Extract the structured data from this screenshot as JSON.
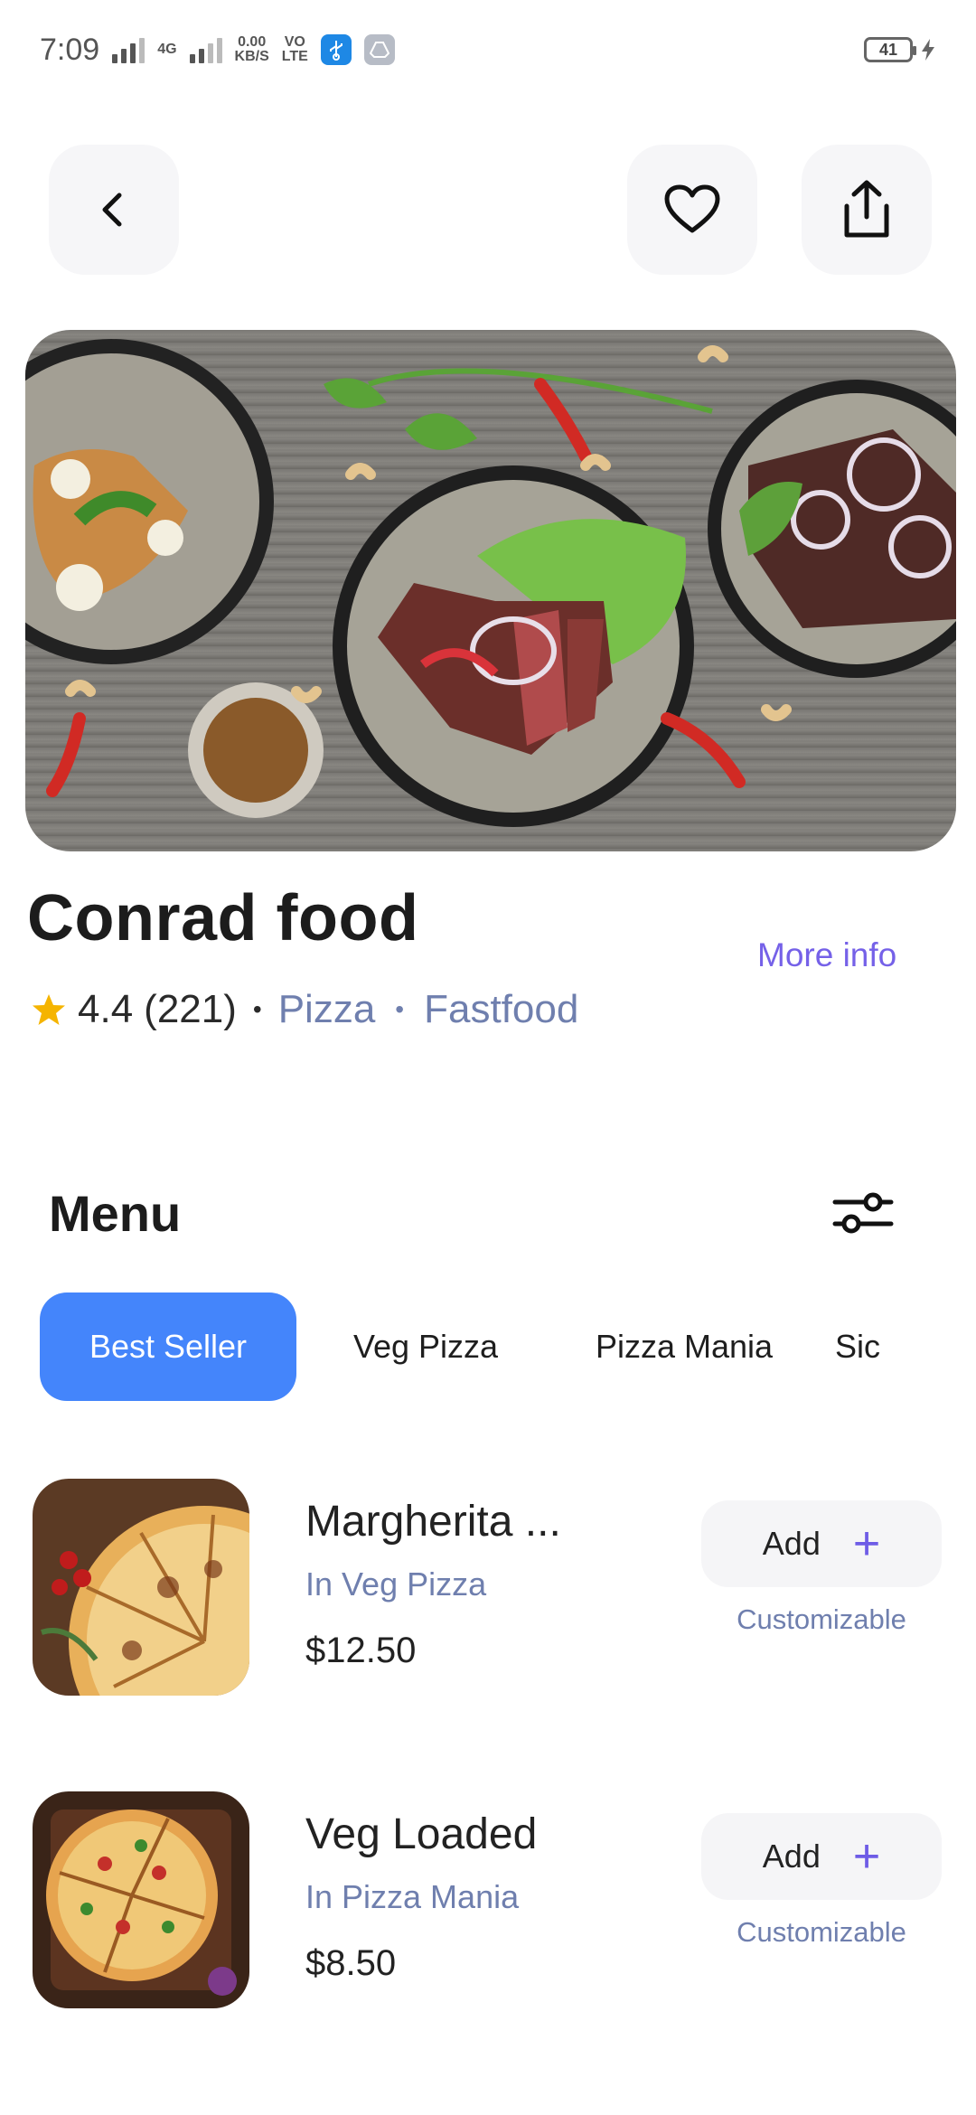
{
  "status_bar": {
    "time": "7:09",
    "net_4g": "4G",
    "speed_value": "0.00",
    "speed_unit": "KB/S",
    "volte_top": "VO",
    "volte_bottom": "LTE",
    "battery": "41"
  },
  "restaurant": {
    "name": "Conrad food",
    "rating": "4.4",
    "reviews": "(221)",
    "separator": "•",
    "tags": [
      "Pizza",
      "Fastfood"
    ],
    "more_info": "More info"
  },
  "menu": {
    "title": "Menu",
    "tabs": [
      {
        "label": "Best Seller",
        "active": true
      },
      {
        "label": "Veg Pizza",
        "active": false
      },
      {
        "label": "Pizza Mania",
        "active": false
      },
      {
        "label": "Sic",
        "active": false
      }
    ],
    "items": [
      {
        "name": "Margherita ...",
        "category": "In Veg Pizza",
        "price": "$12.50",
        "add_label": "Add",
        "note": "Customizable"
      },
      {
        "name": "Veg Loaded",
        "category": "In Pizza Mania",
        "price": "$8.50",
        "add_label": "Add",
        "note": "Customizable"
      }
    ]
  },
  "colors": {
    "accent_blue": "#4485fb",
    "accent_purple": "#7561e8",
    "tag_gray_blue": "#6f7fae",
    "star": "#f5b400"
  },
  "icons": {
    "back": "chevron-left-icon",
    "favorite": "heart-icon",
    "share": "share-icon",
    "filter": "sliders-icon",
    "rating": "star-icon",
    "add": "plus-icon"
  }
}
